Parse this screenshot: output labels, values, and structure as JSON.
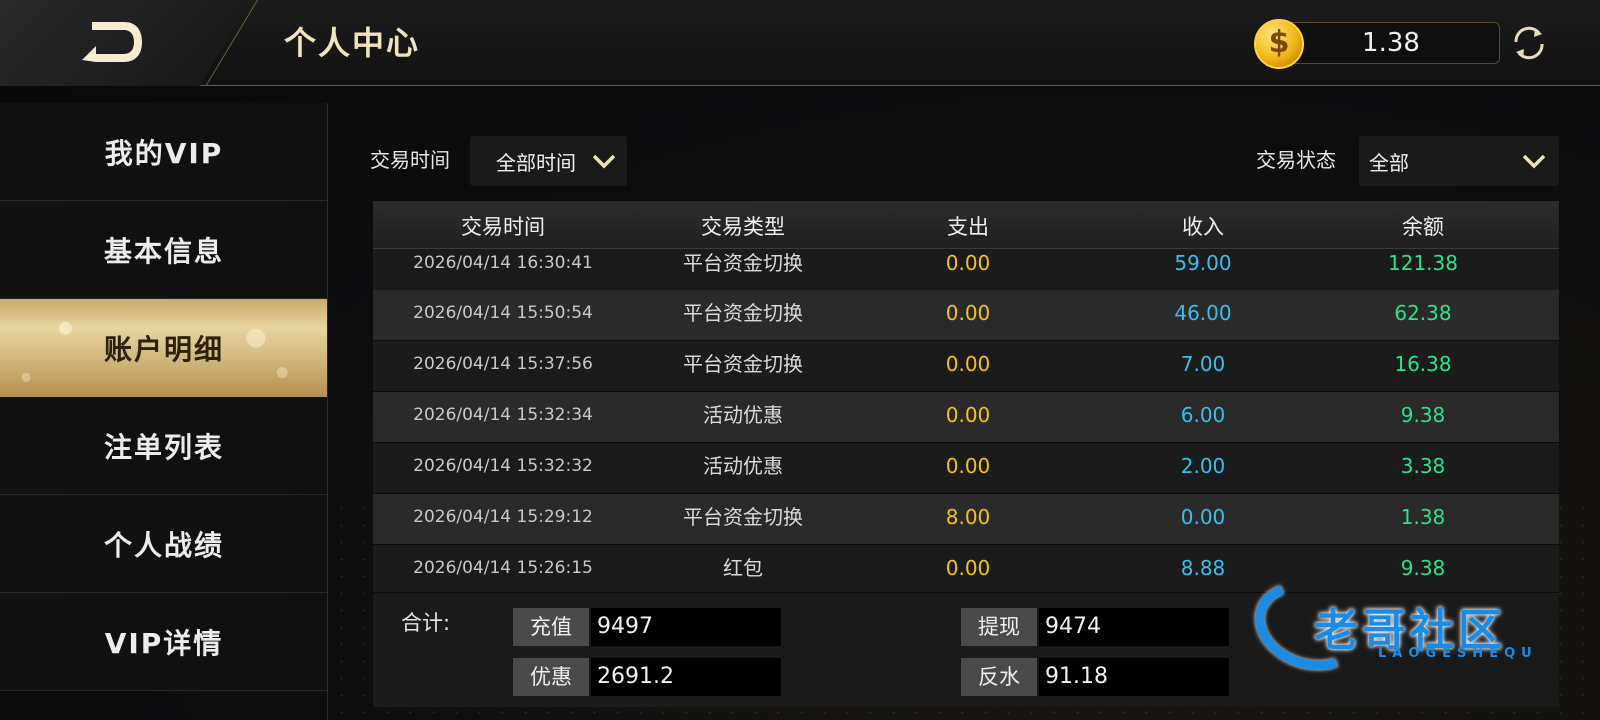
{
  "header": {
    "title": "个人中心",
    "balance": "1.38"
  },
  "sidebar": {
    "items": [
      {
        "label": "我的VIP"
      },
      {
        "label": "基本信息"
      },
      {
        "label": "账户明细",
        "active": true
      },
      {
        "label": "注单列表"
      },
      {
        "label": "个人战绩"
      },
      {
        "label": "VIP详情"
      }
    ]
  },
  "filters": {
    "time_label": "交易时间",
    "time_value": "全部时间",
    "status_label": "交易状态",
    "status_value": "全部"
  },
  "table": {
    "headers": [
      "交易时间",
      "交易类型",
      "支出",
      "收入",
      "余额"
    ],
    "rows": [
      {
        "time": "2026/04/14 16:30:41",
        "type": "平台资金切换",
        "out": "0.00",
        "in": "59.00",
        "balance": "121.38"
      },
      {
        "time": "2026/04/14 15:50:54",
        "type": "平台资金切换",
        "out": "0.00",
        "in": "46.00",
        "balance": "62.38"
      },
      {
        "time": "2026/04/14 15:37:56",
        "type": "平台资金切换",
        "out": "0.00",
        "in": "7.00",
        "balance": "16.38"
      },
      {
        "time": "2026/04/14 15:32:34",
        "type": "活动优惠",
        "out": "0.00",
        "in": "6.00",
        "balance": "9.38"
      },
      {
        "time": "2026/04/14 15:32:32",
        "type": "活动优惠",
        "out": "0.00",
        "in": "2.00",
        "balance": "3.38"
      },
      {
        "time": "2026/04/14 15:29:12",
        "type": "平台资金切换",
        "out": "8.00",
        "in": "0.00",
        "balance": "1.38"
      },
      {
        "time": "2026/04/14 15:26:15",
        "type": "红包",
        "out": "0.00",
        "in": "8.88",
        "balance": "9.38"
      }
    ]
  },
  "totals": {
    "title": "合计:",
    "recharge_label": "充值",
    "recharge_value": "9497",
    "withdraw_label": "提现",
    "withdraw_value": "9474",
    "promo_label": "优惠",
    "promo_value": "2691.2",
    "rebate_label": "反水",
    "rebate_value": "91.18"
  },
  "watermark": {
    "text": "老哥社区",
    "sub": "LAOGESHEQU"
  },
  "colors": {
    "gold": "#f1e3bd",
    "expense": "#f4c21b",
    "income": "#39bfee",
    "balance": "#2fe28a"
  },
  "icons": {
    "back": "back-arrow-icon",
    "coin": "coin-icon",
    "refresh": "refresh-icon",
    "dropdown": "chevron-down-icon"
  }
}
